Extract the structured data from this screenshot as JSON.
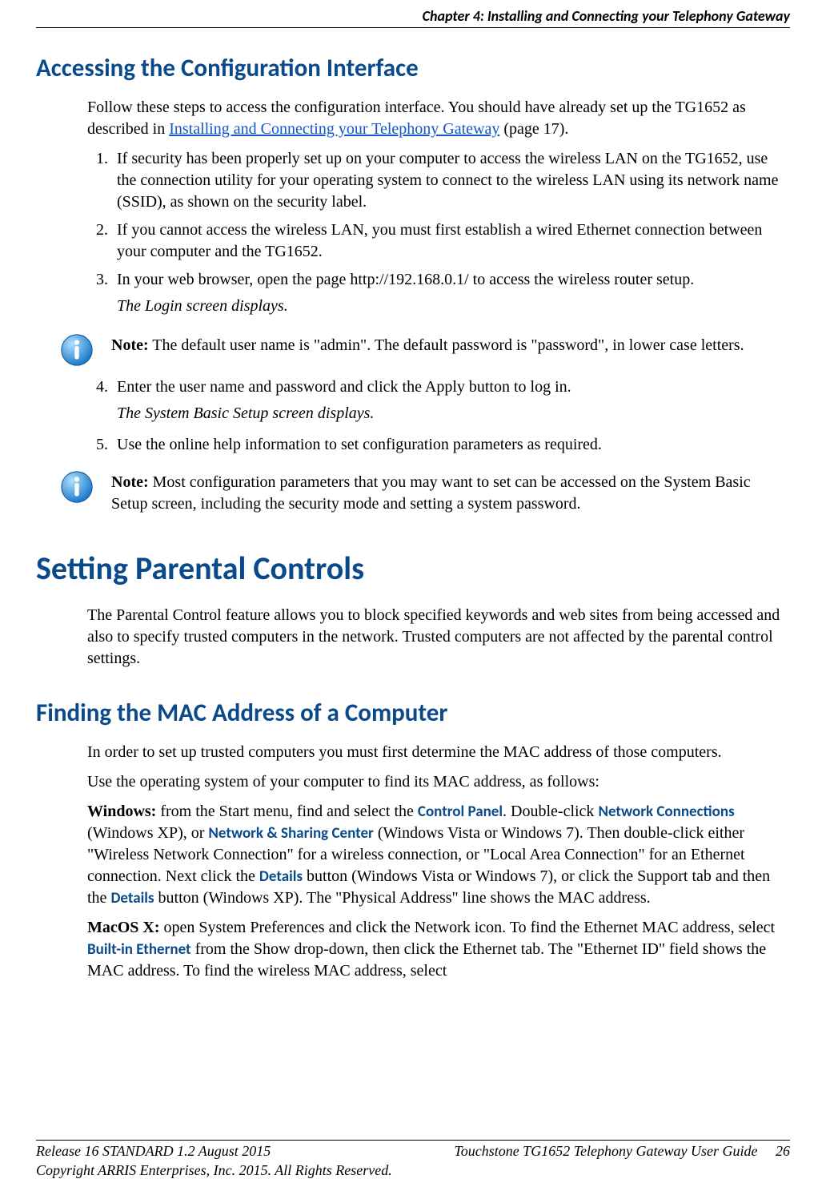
{
  "header": {
    "running": "Chapter 4: Installing and Connecting your Telephony Gateway"
  },
  "s1": {
    "title": "Accessing the Configuration Interface",
    "intro_pre": "Follow these steps to access the configuration interface. You should have already set up the TG1652 as described in ",
    "intro_link": "Installing and Connecting your Telephony Gateway",
    "intro_post": " (page 17).",
    "steps": [
      "If security has been properly set up on your computer to access the wireless LAN on the TG1652, use the connection utility for your operating system to connect to the wireless LAN using its network name (SSID), as shown on the security label.",
      "If you cannot access the wireless LAN, you must first establish a wired Ethernet connection between your computer and the TG1652.",
      "In your web browser, open the page http://192.168.0.1/ to access the wireless router setup."
    ],
    "result1": "The Login screen displays.",
    "note1_label": "Note:",
    "note1_body": " The default user name is \"admin\". The default password is \"password\", in lower case letters.",
    "step4": "Enter the user name and password and click the Apply button to log in.",
    "result2": "The System Basic Setup screen displays.",
    "step5": "Use the online help information to set configuration parameters as required.",
    "note2_label": "Note:",
    "note2_body": " Most configuration parameters that you may want to set can be accessed on the System Basic Setup screen, including the security mode and setting a system password."
  },
  "s2": {
    "title": "Setting Parental Controls",
    "intro": "The Parental Control feature allows you to block specified keywords and web sites from being accessed and also to specify trusted computers in the network. Trusted computers are not affected by the parental control settings."
  },
  "s3": {
    "title": "Finding the MAC Address of a Computer",
    "p1": "In order to set up trusted computers you must first determine the MAC address of those computers.",
    "p2": "Use the operating system of your computer to find its MAC address, as follows:",
    "win_label": "Windows:",
    "win_1": " from the Start menu, find and select the ",
    "win_ui1": "Control Panel",
    "win_2": ". Double-click ",
    "win_ui2": "Network Connections",
    "win_3": " (Windows XP), or ",
    "win_ui3": "Network & Sharing Center",
    "win_4": " (Windows Vista or Windows 7). Then double-click either \"Wireless Network Connection\" for a wireless connection, or \"Local Area Connection\" for an Ethernet connection. Next click the ",
    "win_ui4": "Details",
    "win_5": " button (Windows Vista or Windows 7), or click the Support tab and then the ",
    "win_ui5": "Details",
    "win_6": " button (Windows XP). The \"Physical Address\" line shows the MAC address.",
    "mac_label": "MacOS X:",
    "mac_1": " open System Preferences and click the Network icon. To find the Ethernet MAC address, select ",
    "mac_ui1": "Built-in Ethernet",
    "mac_2": " from the Show drop-down, then click the Ethernet tab. The \"Ethernet ID\" field shows the MAC address. To find the wireless MAC address, select"
  },
  "footer": {
    "release": "Release 16 STANDARD 1.2    August 2015",
    "doc": "Touchstone TG1652 Telephony Gateway User Guide",
    "page": "26",
    "copyright": "Copyright ARRIS Enterprises, Inc. 2015. All Rights Reserved."
  }
}
